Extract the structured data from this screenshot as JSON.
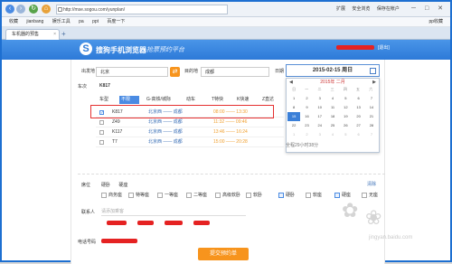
{
  "browser": {
    "url": "http://mse.sogou.com/yunplan/",
    "tools": [
      "扩展",
      "安全浏览",
      "保存在帐户"
    ],
    "win_controls": "─ □ ✕",
    "favorites": [
      "收藏",
      "jianbang",
      "娱乐工具",
      "pa",
      "ppt",
      "百度一下"
    ],
    "fav_right": "pp收藏",
    "tab_label": "车机器的预售",
    "tab_close": "×",
    "tab_new": "+"
  },
  "banner": {
    "title": "搜狗手机浏览器",
    "slogan": "抢票预约平台",
    "logout": "[退出]"
  },
  "form": {
    "from_label": "出发地",
    "from_value": "北京",
    "swap_icon": "⇄",
    "to_label": "目的地",
    "to_value": "成都",
    "date_label": "日期",
    "date_value": "2015-02-15 周日",
    "train_label": "车次",
    "train_value": "K817"
  },
  "calendar": {
    "month": "2015年 二月",
    "prev": "◀",
    "next": "▶",
    "weekdays": [
      "日",
      "一",
      "二",
      "三",
      "四",
      "五",
      "六"
    ],
    "days": [
      {
        "d": "1",
        "state": ""
      },
      {
        "d": "2",
        "state": ""
      },
      {
        "d": "3",
        "state": ""
      },
      {
        "d": "4",
        "state": ""
      },
      {
        "d": "5",
        "state": ""
      },
      {
        "d": "6",
        "state": ""
      },
      {
        "d": "7",
        "state": ""
      },
      {
        "d": "8",
        "state": ""
      },
      {
        "d": "9",
        "state": ""
      },
      {
        "d": "10",
        "state": ""
      },
      {
        "d": "11",
        "state": ""
      },
      {
        "d": "12",
        "state": ""
      },
      {
        "d": "13",
        "state": ""
      },
      {
        "d": "14",
        "state": ""
      },
      {
        "d": "15",
        "state": "sel"
      },
      {
        "d": "16",
        "state": ""
      },
      {
        "d": "17",
        "state": ""
      },
      {
        "d": "18",
        "state": ""
      },
      {
        "d": "19",
        "state": ""
      },
      {
        "d": "20",
        "state": ""
      },
      {
        "d": "21",
        "state": ""
      },
      {
        "d": "22",
        "state": ""
      },
      {
        "d": "23",
        "state": ""
      },
      {
        "d": "24",
        "state": ""
      },
      {
        "d": "25",
        "state": ""
      },
      {
        "d": "26",
        "state": ""
      },
      {
        "d": "27",
        "state": ""
      },
      {
        "d": "28",
        "state": ""
      },
      {
        "d": "1",
        "state": "mut"
      },
      {
        "d": "2",
        "state": "mut"
      },
      {
        "d": "3",
        "state": "mut"
      },
      {
        "d": "4",
        "state": "mut"
      },
      {
        "d": "5",
        "state": "mut"
      },
      {
        "d": "6",
        "state": "mut"
      },
      {
        "d": "7",
        "state": "mut"
      }
    ]
  },
  "filters": {
    "type_label": "车型",
    "all": "不限",
    "g": "G-高铁/城际",
    "d": "动车",
    "t": "T特快",
    "k": "K快速",
    "z": "Z直达"
  },
  "trains": [
    {
      "no": "K817",
      "route": "北京西 —— 成都",
      "time": "08:00 —— 13:30",
      "checked": true
    },
    {
      "no": "Z49",
      "route": "北京西 —— 成都",
      "time": "11:32 —— 09:46",
      "checked": false
    },
    {
      "no": "K117",
      "route": "北京西 —— 成都",
      "time": "13:46 —— 16:24",
      "checked": false
    },
    {
      "no": "T7",
      "route": "北京西 —— 成都",
      "time": "15:00 —— 20:28",
      "checked": false
    }
  ],
  "free_note": "全程29小时38分",
  "seats": {
    "label": "席位",
    "tabs": [
      "硬卧",
      "硬座"
    ],
    "clear": "清除",
    "options": [
      {
        "name": "商务座",
        "on": false
      },
      {
        "name": "特等座",
        "on": false
      },
      {
        "name": "一等座",
        "on": false
      },
      {
        "name": "二等座",
        "on": false
      },
      {
        "name": "高级软卧",
        "on": false
      },
      {
        "name": "软卧",
        "on": false
      },
      {
        "name": "硬卧",
        "on": true
      },
      {
        "name": "软座",
        "on": false
      },
      {
        "name": "硬座",
        "on": true
      },
      {
        "name": "无座",
        "on": false
      }
    ]
  },
  "contact": {
    "label": "联系人",
    "placeholder": "请添加乘客",
    "phone_label": "电话号码"
  },
  "submit": "提交预约单",
  "watermark": "jingyan.baidu.com",
  "icon_names": [
    "back-icon",
    "forward-icon",
    "refresh-icon",
    "lock-icon",
    "calendar-icon",
    "swap-icon",
    "close-icon"
  ]
}
